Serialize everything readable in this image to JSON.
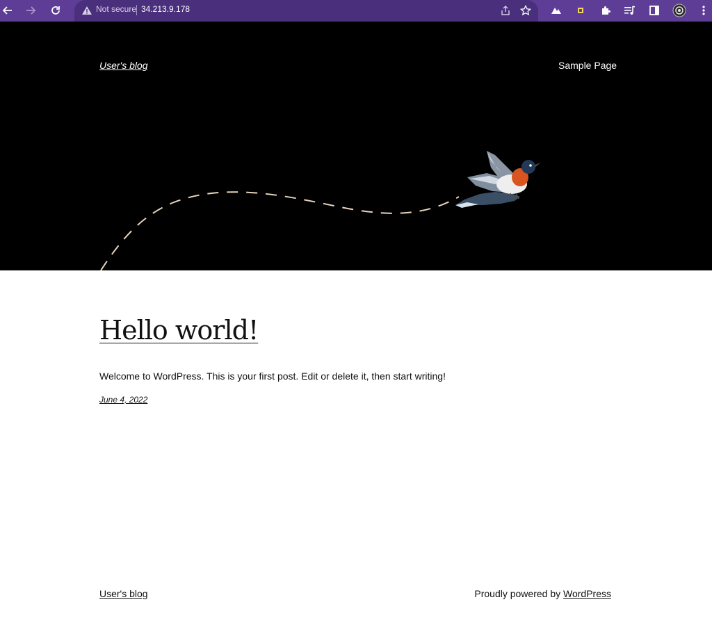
{
  "browser": {
    "security_label": "Not secure",
    "url": "34.213.9.178",
    "icons": [
      "back-arrow-icon",
      "forward-arrow-icon",
      "reload-icon",
      "warning-icon",
      "share-icon",
      "bookmark-star-icon",
      "extension-mountain-icon",
      "extension-square-icon",
      "puzzle-extensions-icon",
      "media-queue-icon",
      "sidepanel-icon",
      "profile-avatar-icon",
      "kebab-menu-icon"
    ],
    "colors": {
      "toolbar": "#5e3d96",
      "omnibox": "#4a2f7c"
    }
  },
  "site": {
    "title": "User's blog",
    "nav": [
      {
        "label": "Sample Page"
      }
    ],
    "header_background": "#000000"
  },
  "post": {
    "title": "Hello world!",
    "excerpt": "Welcome to WordPress. This is your first post. Edit or delete it, then start writing!",
    "date": "June 4, 2022"
  },
  "footer": {
    "site_title": "User's blog",
    "credit_prefix": "Proudly powered by ",
    "credit_link": "WordPress"
  }
}
